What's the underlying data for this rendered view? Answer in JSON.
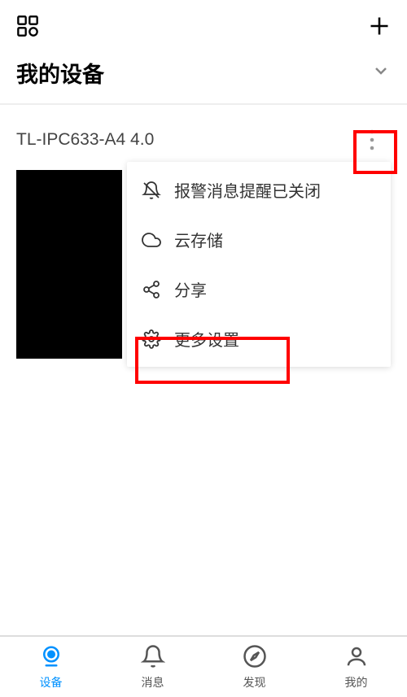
{
  "header": {
    "title": "我的设备"
  },
  "device": {
    "name": "TL-IPC633-A4 4.0"
  },
  "popup": {
    "items": [
      {
        "label": "报警消息提醒已关闭",
        "icon": "bell-off"
      },
      {
        "label": "云存储",
        "icon": "cloud"
      },
      {
        "label": "分享",
        "icon": "share"
      },
      {
        "label": "更多设置",
        "icon": "gear"
      }
    ]
  },
  "nav": {
    "items": [
      {
        "label": "设备",
        "active": true
      },
      {
        "label": "消息",
        "active": false
      },
      {
        "label": "发现",
        "active": false
      },
      {
        "label": "我的",
        "active": false
      }
    ]
  }
}
